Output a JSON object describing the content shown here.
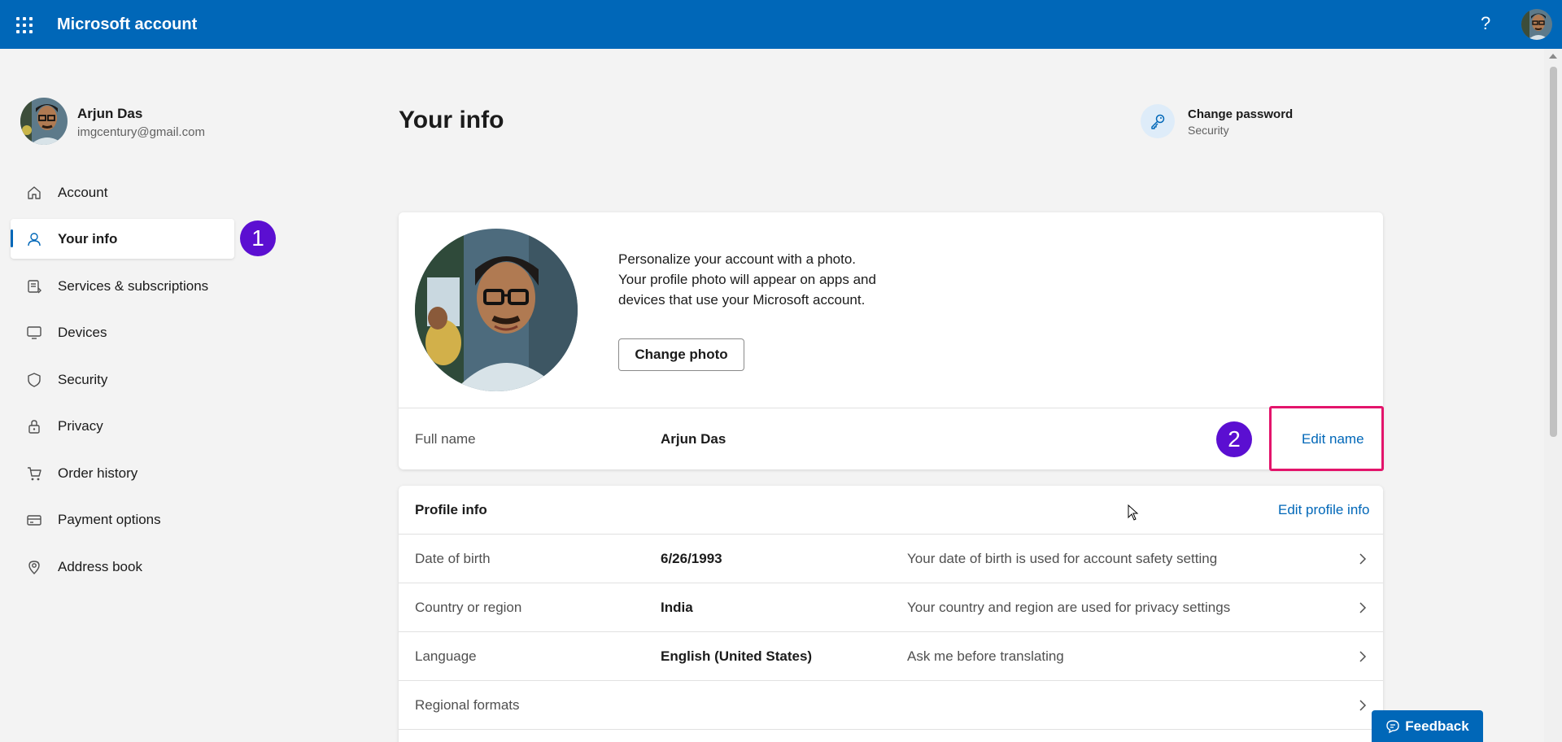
{
  "header": {
    "app_title": "Microsoft account",
    "help_glyph": "?",
    "brand_color": "#0067b8"
  },
  "user": {
    "name": "Arjun Das",
    "email": "imgcentury@gmail.com"
  },
  "sidebar": {
    "items": [
      {
        "label": "Account",
        "icon": "home-icon"
      },
      {
        "label": "Your info",
        "icon": "person-icon",
        "active": true
      },
      {
        "label": "Services & subscriptions",
        "icon": "subscriptions-icon"
      },
      {
        "label": "Devices",
        "icon": "monitor-icon"
      },
      {
        "label": "Security",
        "icon": "shield-icon"
      },
      {
        "label": "Privacy",
        "icon": "lock-icon"
      },
      {
        "label": "Order history",
        "icon": "cart-icon"
      },
      {
        "label": "Payment options",
        "icon": "credit-card-icon"
      },
      {
        "label": "Address book",
        "icon": "location-pin-icon"
      }
    ]
  },
  "badges": {
    "step1": "1",
    "step2": "2",
    "color": "#5b0fd1",
    "highlight_color": "#e3146b"
  },
  "main": {
    "title": "Your info",
    "quick_link": {
      "title": "Change password",
      "subtitle": "Security",
      "icon": "key-icon"
    },
    "photo_card": {
      "text": "Personalize your account with a photo. Your profile photo will appear on apps and devices that use your Microsoft account.",
      "change_photo_label": "Change photo",
      "full_name_label": "Full name",
      "full_name_value": "Arjun Das",
      "edit_name_label": "Edit name"
    },
    "profile_info": {
      "heading": "Profile info",
      "edit_label": "Edit profile info",
      "rows": [
        {
          "label": "Date of birth",
          "value": "6/26/1993",
          "desc": "Your date of birth is used for account safety setting"
        },
        {
          "label": "Country or region",
          "value": "India",
          "desc": "Your country and region are used for privacy settings"
        },
        {
          "label": "Language",
          "value": "English (United States)",
          "desc": "Ask me before translating"
        },
        {
          "label": "Regional formats",
          "value": "",
          "desc": ""
        }
      ]
    }
  },
  "feedback": {
    "label": "Feedback"
  }
}
